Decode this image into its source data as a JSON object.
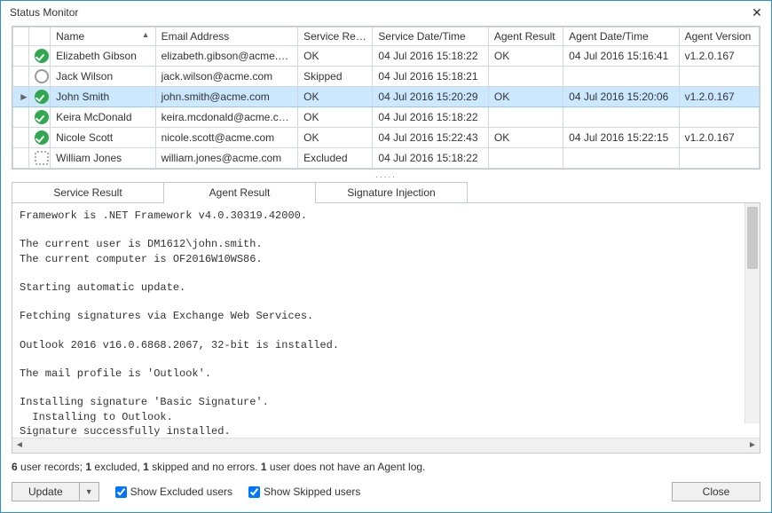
{
  "window": {
    "title": "Status Monitor"
  },
  "columns": {
    "name": "Name",
    "email": "Email Address",
    "service_result": "Service Result",
    "service_dt": "Service Date/Time",
    "agent_result": "Agent Result",
    "agent_dt": "Agent Date/Time",
    "agent_ver": "Agent Version"
  },
  "rows": [
    {
      "status": "ok",
      "name": "Elizabeth Gibson",
      "email": "elizabeth.gibson@acme.com",
      "sres": "OK",
      "sdt": "04 Jul 2016 15:18:22",
      "ares": "OK",
      "adt": "04 Jul 2016 15:16:41",
      "aver": "v1.2.0.167",
      "selected": false,
      "indicator": ""
    },
    {
      "status": "skip",
      "name": "Jack Wilson",
      "email": "jack.wilson@acme.com",
      "sres": "Skipped",
      "sdt": "04 Jul 2016 15:18:21",
      "ares": "",
      "adt": "",
      "aver": "",
      "selected": false,
      "indicator": ""
    },
    {
      "status": "ok",
      "name": "John Smith",
      "email": "john.smith@acme.com",
      "sres": "OK",
      "sdt": "04 Jul 2016 15:20:29",
      "ares": "OK",
      "adt": "04 Jul 2016 15:20:06",
      "aver": "v1.2.0.167",
      "selected": true,
      "indicator": "►"
    },
    {
      "status": "ok",
      "name": "Keira McDonald",
      "email": "keira.mcdonald@acme.com",
      "sres": "OK",
      "sdt": "04 Jul 2016 15:18:22",
      "ares": "",
      "adt": "",
      "aver": "",
      "selected": false,
      "indicator": ""
    },
    {
      "status": "ok",
      "name": "Nicole Scott",
      "email": "nicole.scott@acme.com",
      "sres": "OK",
      "sdt": "04 Jul 2016 15:22:43",
      "ares": "OK",
      "adt": "04 Jul 2016 15:22:15",
      "aver": "v1.2.0.167",
      "selected": false,
      "indicator": ""
    },
    {
      "status": "excl",
      "name": "William Jones",
      "email": "william.jones@acme.com",
      "sres": "Excluded",
      "sdt": "04 Jul 2016 15:18:22",
      "ares": "",
      "adt": "",
      "aver": "",
      "selected": false,
      "indicator": ""
    }
  ],
  "tabs": {
    "service_result": "Service Result",
    "agent_result": "Agent Result",
    "signature_injection": "Signature Injection",
    "active": "agent_result"
  },
  "log": "Framework is .NET Framework v4.0.30319.42000.\n\nThe current user is DM1612\\john.smith.\nThe current computer is OF2016W10WS86.\n\nStarting automatic update.\n\nFetching signatures via Exchange Web Services.\n\nOutlook 2016 v16.0.6868.2067, 32-bit is installed.\n\nThe mail profile is 'Outlook'.\n\nInstalling signature 'Basic Signature'.\n  Installing to Outlook.\nSignature successfully installed.\n\nApplying global Outlook Client Settings.",
  "summary": {
    "records_n": "6",
    "text1": " user records; ",
    "excluded_n": "1",
    "text2": " excluded, ",
    "skipped_n": "1",
    "text3": " skipped and no errors. ",
    "no_agent_n": "1",
    "text4": " user does not have an Agent log."
  },
  "footer": {
    "update_label": "Update",
    "show_excluded_label": "Show Excluded users",
    "show_excluded_checked": true,
    "show_skipped_label": "Show Skipped users",
    "show_skipped_checked": true,
    "close_label": "Close"
  },
  "splitter_dots": "....."
}
